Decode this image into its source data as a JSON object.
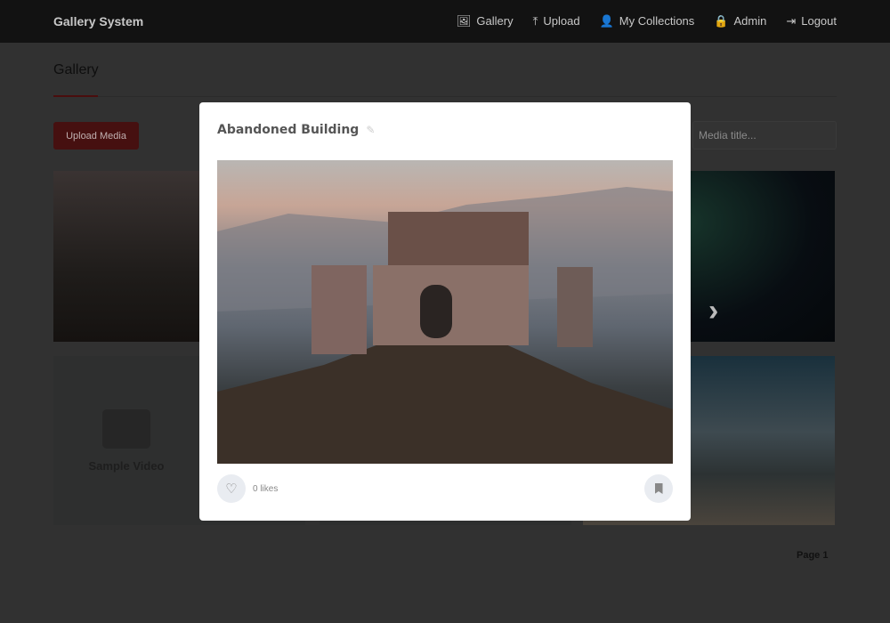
{
  "navbar": {
    "brand": "Gallery System",
    "links": [
      {
        "icon": "images-icon",
        "glyph": "🖼",
        "label": "Gallery"
      },
      {
        "icon": "upload-icon",
        "glyph": "⤒",
        "label": "Upload"
      },
      {
        "icon": "user-icon",
        "glyph": "👤",
        "label": "My Collections"
      },
      {
        "icon": "lock-icon",
        "glyph": "🔒",
        "label": "Admin"
      },
      {
        "icon": "logout-icon",
        "glyph": "⇥",
        "label": "Logout"
      }
    ]
  },
  "page": {
    "title": "Gallery",
    "upload_button": "Upload Media",
    "search_placeholder": "Media title...",
    "video_tile_label": "Sample Video",
    "pagination": "Page 1"
  },
  "modal": {
    "title": "Abandoned Building",
    "likes": "0 likes"
  },
  "colors": {
    "accent": "#8b1a1a",
    "navbar": "#1a1a1a"
  }
}
